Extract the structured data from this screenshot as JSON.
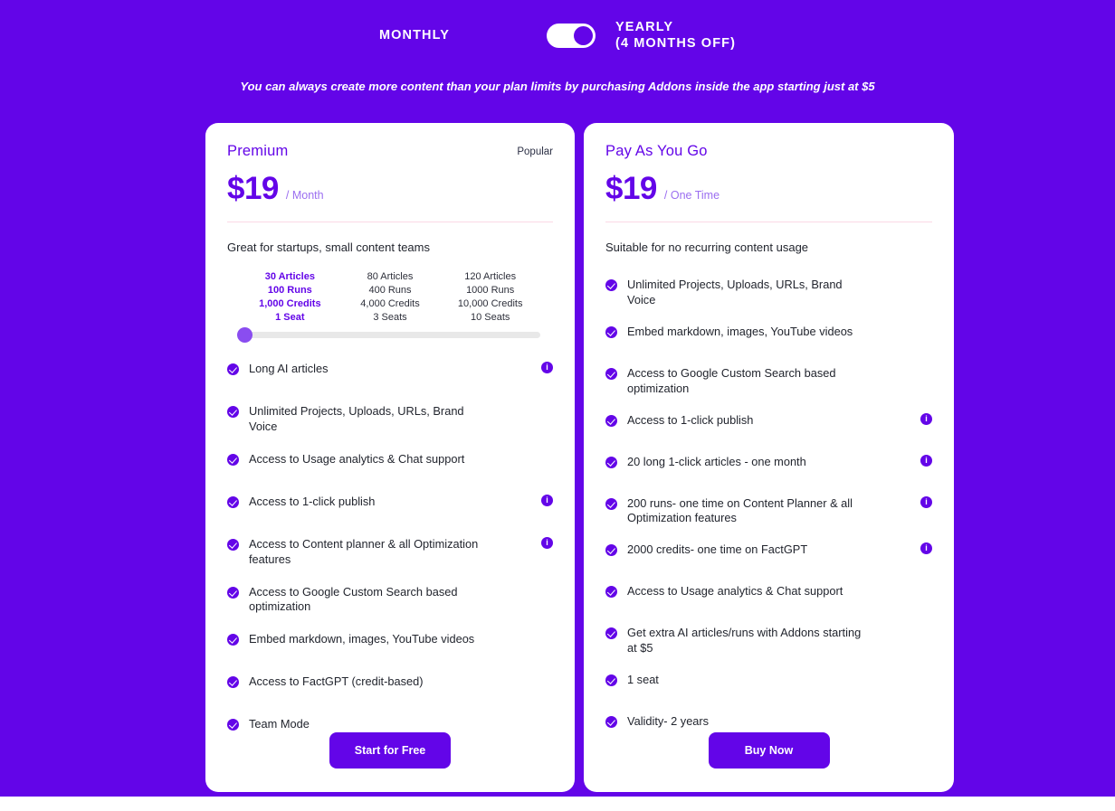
{
  "billing": {
    "monthly_label": "MONTHLY",
    "yearly_label": "YEARLY",
    "yearly_sub_label": "(4 MONTHS OFF)",
    "toggle_state": "yearly"
  },
  "addon_note": "You can always create more content than your plan limits by purchasing Addons inside the app starting just at $5",
  "colors": {
    "background": "#6305e8",
    "accent": "#6305e8",
    "card": "#ffffff",
    "divider": "#fbd9e6",
    "slider_knob": "#8a4df0",
    "slider_track": "#e8e8e8",
    "period_text": "#9b6ef0"
  },
  "plans": [
    {
      "name": "Premium",
      "badge": "Popular",
      "price": "$19",
      "period": "/ Month",
      "tagline": "Great for startups, small content teams",
      "tiers": {
        "active_index": 0,
        "columns": [
          {
            "articles": "30 Articles",
            "runs": "100 Runs",
            "credits": "1,000 Credits",
            "seats": "1 Seat"
          },
          {
            "articles": "80 Articles",
            "runs": "400 Runs",
            "credits": "4,000 Credits",
            "seats": "3 Seats"
          },
          {
            "articles": "120 Articles",
            "runs": "1000 Runs",
            "credits": "10,000 Credits",
            "seats": "10 Seats"
          }
        ]
      },
      "features": [
        {
          "text": "Long AI articles",
          "info": true
        },
        {
          "text": "Unlimited Projects, Uploads, URLs, Brand Voice",
          "info": false
        },
        {
          "text": "Access to Usage analytics & Chat support",
          "info": false
        },
        {
          "text": "Access to 1-click publish",
          "info": true
        },
        {
          "text": "Access to Content planner & all Optimization features",
          "info": true
        },
        {
          "text": "Access to Google Custom Search based optimization",
          "info": false
        },
        {
          "text": "Embed markdown, images, YouTube videos",
          "info": false
        },
        {
          "text": "Access to FactGPT (credit-based)",
          "info": false
        },
        {
          "text": "Team Mode",
          "info": false
        }
      ],
      "cta": "Start for Free"
    },
    {
      "name": "Pay As You Go",
      "badge": "",
      "price": "$19",
      "period": "/ One Time",
      "tagline": "Suitable for no recurring content usage",
      "features": [
        {
          "text": "Unlimited Projects, Uploads, URLs, Brand Voice",
          "info": false
        },
        {
          "text": "Embed markdown, images, YouTube videos",
          "info": false
        },
        {
          "text": "Access to Google Custom Search based optimization",
          "info": false
        },
        {
          "text": "Access to 1-click publish",
          "info": true
        },
        {
          "text": "20 long 1-click articles - one month",
          "info": true
        },
        {
          "text": "200 runs- one time on Content Planner & all Optimization features",
          "info": true
        },
        {
          "text": "2000 credits- one time on FactGPT",
          "info": true
        },
        {
          "text": "Access to Usage analytics & Chat support",
          "info": false
        },
        {
          "text": "Get extra AI articles/runs with Addons starting at $5",
          "info": false
        },
        {
          "text": "1 seat",
          "info": false
        },
        {
          "text": "Validity- 2 years",
          "info": false
        }
      ],
      "cta": "Buy Now"
    }
  ],
  "icons": {
    "check": "check-circle-icon",
    "info": "i"
  }
}
